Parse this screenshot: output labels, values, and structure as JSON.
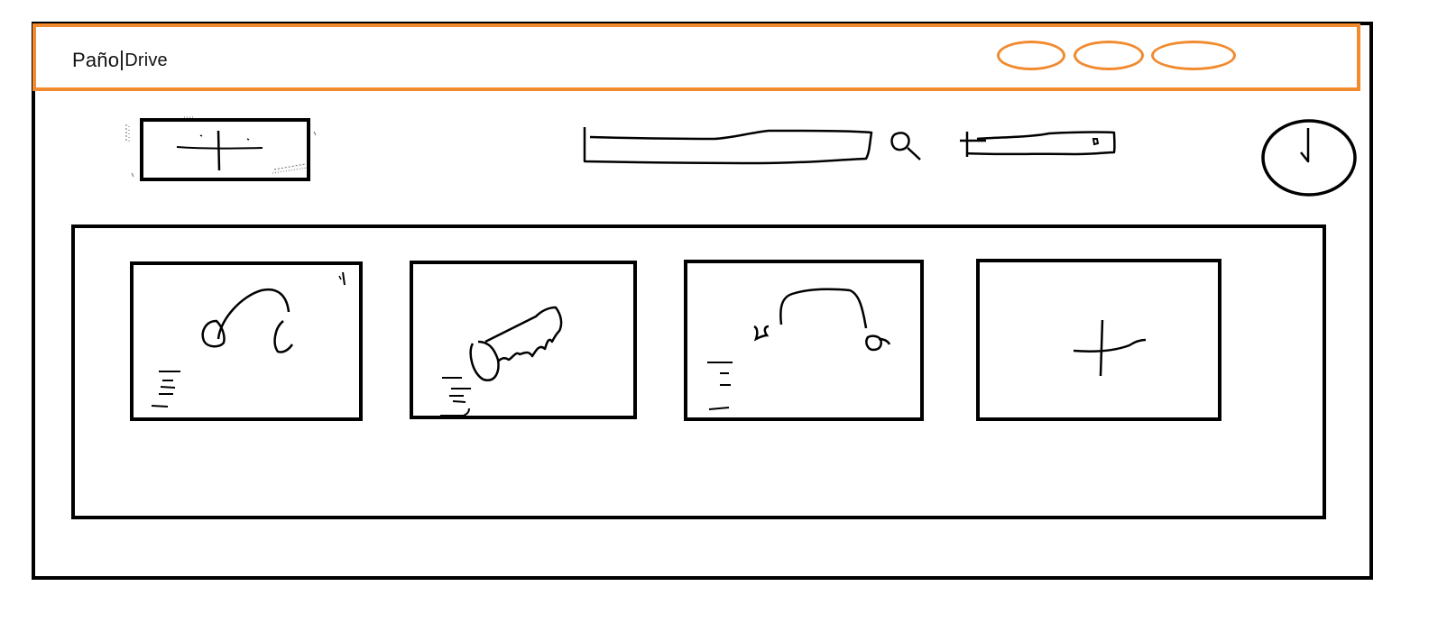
{
  "app": {
    "brand_first": "Paño",
    "brand_second": "Drive"
  },
  "colors": {
    "accent": "#f28a2e",
    "ink": "#000000",
    "background": "#ffffff"
  },
  "header": {
    "nav_items": [
      {
        "icon": "oval-nav-icon"
      },
      {
        "icon": "oval-nav-icon"
      },
      {
        "icon": "oval-nav-icon"
      }
    ]
  },
  "toolbar": {
    "add_button_icon": "plus-icon",
    "search_icon": "search-icon",
    "filter_icon": "plus-icon",
    "clock_icon": "clock-icon"
  },
  "cards": [
    {
      "icon": "headphones-icon"
    },
    {
      "icon": "drill-tool-icon"
    },
    {
      "icon": "headset-icon"
    },
    {
      "icon": "plus-icon"
    }
  ]
}
